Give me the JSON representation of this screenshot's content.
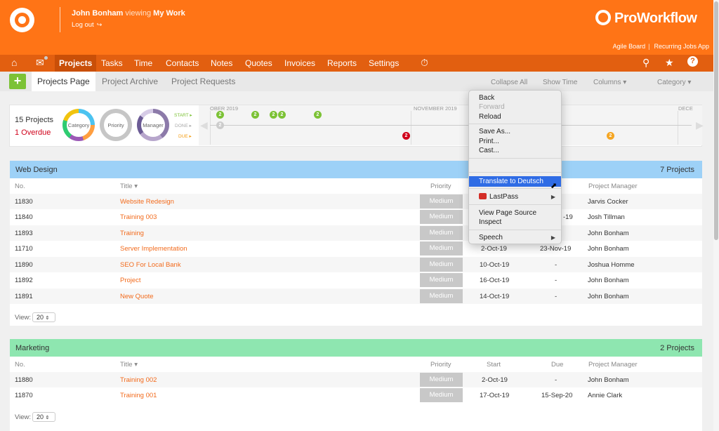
{
  "header": {
    "user": "John Bonham",
    "viewing": "viewing",
    "view_name": "My Work",
    "logout": "Log out",
    "brand": "ProWorkflow",
    "links": [
      "Agile Board",
      "Recurring Jobs App"
    ],
    "brand_color": "#ff7416"
  },
  "nav": {
    "items": [
      "Projects",
      "Tasks",
      "Time",
      "Contacts",
      "Notes",
      "Quotes",
      "Invoices",
      "Reports",
      "Settings"
    ],
    "active": "Projects",
    "icons": [
      "home-icon",
      "mail-icon",
      "timer-icon",
      "search-icon",
      "star-icon",
      "help-icon"
    ]
  },
  "subbar": {
    "add": "+",
    "tabs": [
      "Projects Page",
      "Project Archive",
      "Project Requests"
    ],
    "controls": [
      "Collapse All",
      "Show Time",
      "Columns",
      "Category"
    ]
  },
  "summary": {
    "count": "15 Projects",
    "overdue": "1 Overdue",
    "donuts": [
      "Category",
      "Priority",
      "Manager"
    ],
    "keys": [
      "START",
      "DONE",
      "DUE"
    ],
    "months": [
      "OBER 2019",
      "NOVEMBER 2019",
      "DECE"
    ],
    "markers": {
      "start": [
        "2",
        "2",
        "2",
        "2",
        "2"
      ],
      "done": "2",
      "due": [
        "2",
        "2"
      ]
    }
  },
  "columns": {
    "no": "No.",
    "title": "Title",
    "priority": "Priority",
    "start": "Start",
    "due": "Due",
    "manager": "Project Manager"
  },
  "groups": [
    {
      "name": "Web Design",
      "count": "7 Projects",
      "color": "#9dd1f7",
      "rows": [
        {
          "no": "11830",
          "title": "Website Redesign",
          "priority": "Medium",
          "start": "",
          "due": "",
          "manager": "Jarvis Cocker"
        },
        {
          "no": "11840",
          "title": "Training 003",
          "priority": "Medium",
          "start": "",
          "due": "-19",
          "manager": "Josh Tillman"
        },
        {
          "no": "11893",
          "title": "Training",
          "priority": "Medium",
          "start": "",
          "due": "",
          "manager": "John Bonham"
        },
        {
          "no": "11710",
          "title": "Server Implementation",
          "priority": "Medium",
          "start": "2-Oct-19",
          "due": "23-Nov-19",
          "manager": "John Bonham"
        },
        {
          "no": "11890",
          "title": "SEO For Local Bank",
          "priority": "Medium",
          "start": "10-Oct-19",
          "due": "-",
          "manager": "Joshua Homme"
        },
        {
          "no": "11892",
          "title": "Project",
          "priority": "Medium",
          "start": "16-Oct-19",
          "due": "-",
          "manager": "John Bonham"
        },
        {
          "no": "11891",
          "title": "New Quote",
          "priority": "Medium",
          "start": "14-Oct-19",
          "due": "-",
          "manager": "John Bonham"
        }
      ],
      "view_label": "View:",
      "view_value": "20"
    },
    {
      "name": "Marketing",
      "count": "2 Projects",
      "color": "#8ee6b0",
      "rows": [
        {
          "no": "11880",
          "title": "Training 002",
          "priority": "Medium",
          "start": "2-Oct-19",
          "due": "-",
          "manager": "John Bonham"
        },
        {
          "no": "11870",
          "title": "Training 001",
          "priority": "Medium",
          "start": "17-Oct-19",
          "due": "15-Sep-20",
          "manager": "Annie Clark"
        }
      ],
      "view_label": "View:",
      "view_value": "20"
    }
  ],
  "context_menu": {
    "items": [
      "Back",
      "Forward",
      "Reload",
      "Save As...",
      "Print...",
      "Cast...",
      "Translate to Deutsch",
      "LastPass",
      "View Page Source",
      "Inspect",
      "Speech"
    ],
    "highlight": "Translate to Deutsch"
  }
}
